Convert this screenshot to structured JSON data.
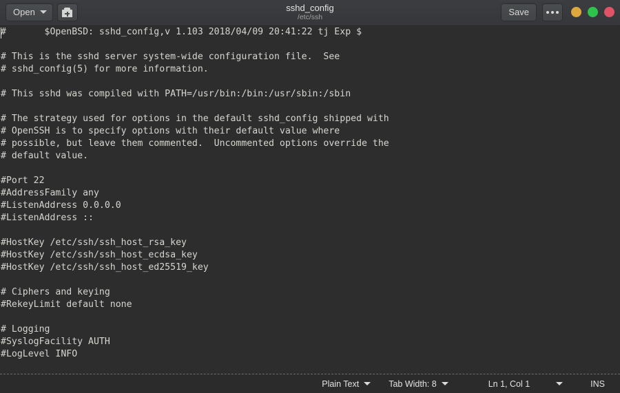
{
  "titlebar": {
    "open_button": "Open",
    "open_caret_icon": "chevron-down-icon",
    "new_document_icon": "new-document-icon",
    "title": "sshd_config",
    "subtitle": "/etc/ssh",
    "save_button": "Save",
    "menu_icon": "more-options-icon",
    "window_controls": [
      {
        "name": "minimize",
        "color": "#e0a83c"
      },
      {
        "name": "maximize",
        "color": "#2ec44b"
      },
      {
        "name": "close",
        "color": "#e05265"
      }
    ]
  },
  "editor": {
    "cursor": {
      "line": 1,
      "column": 1
    },
    "lines": [
      "#\t$OpenBSD: sshd_config,v 1.103 2018/04/09 20:41:22 tj Exp $",
      "",
      "# This is the sshd server system-wide configuration file.  See",
      "# sshd_config(5) for more information.",
      "",
      "# This sshd was compiled with PATH=/usr/bin:/bin:/usr/sbin:/sbin",
      "",
      "# The strategy used for options in the default sshd_config shipped with",
      "# OpenSSH is to specify options with their default value where",
      "# possible, but leave them commented.  Uncommented options override the",
      "# default value.",
      "",
      "#Port 22",
      "#AddressFamily any",
      "#ListenAddress 0.0.0.0",
      "#ListenAddress ::",
      "",
      "#HostKey /etc/ssh/ssh_host_rsa_key",
      "#HostKey /etc/ssh/ssh_host_ecdsa_key",
      "#HostKey /etc/ssh/ssh_host_ed25519_key",
      "",
      "# Ciphers and keying",
      "#RekeyLimit default none",
      "",
      "# Logging",
      "#SyslogFacility AUTH",
      "#LogLevel INFO"
    ]
  },
  "statusbar": {
    "language": "Plain Text",
    "tab_width": "Tab Width: 8",
    "position": "Ln 1, Col 1",
    "insert_mode": "INS"
  },
  "colors": {
    "titlebar_bg": "#383a3c",
    "editor_bg": "#2d2d2d",
    "editor_fg": "#d6d6d0",
    "statusbar_bg": "#2b2b2b"
  }
}
